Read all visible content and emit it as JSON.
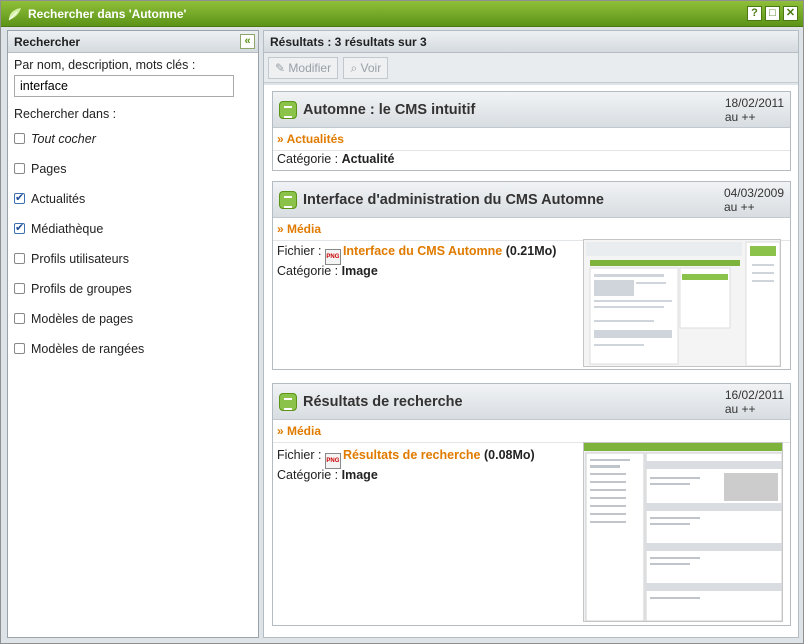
{
  "window": {
    "title": "Rechercher dans 'Automne'",
    "btn_help": "?",
    "btn_max": "□",
    "btn_close": "✕"
  },
  "left": {
    "header": "Rechercher",
    "collapse": "«",
    "search_label": "Par nom, description, mots clés :",
    "search_value": "interface",
    "search_in_label": "Rechercher dans :",
    "checkboxes": [
      {
        "label": "Tout cocher",
        "checked": false
      },
      {
        "label": "Pages",
        "checked": false
      },
      {
        "label": "Actualités",
        "checked": true
      },
      {
        "label": "Médiathèque",
        "checked": true
      },
      {
        "label": "Profils utilisateurs",
        "checked": false
      },
      {
        "label": "Profils de groupes",
        "checked": false
      },
      {
        "label": "Modèles de pages",
        "checked": false
      },
      {
        "label": "Modèles de rangées",
        "checked": false
      }
    ]
  },
  "right": {
    "header": "Résultats : 3 résultats sur 3",
    "modify_label": "Modifier",
    "view_label": "Voir"
  },
  "results": [
    {
      "title": "Automne : le CMS intuitif",
      "date": "18/02/2011",
      "by": "au ++",
      "module": "» Actualités",
      "category_label": "Catégorie :",
      "category": "Actualité"
    },
    {
      "title": "Interface d'administration du CMS Automne",
      "date": "04/03/2009",
      "by": "au ++",
      "module": "» Média",
      "file_label": "Fichier :",
      "file_name": "Interface du CMS Automne",
      "file_size": "(0.21Mo)",
      "file_type": "PNG",
      "category_label": "Catégorie :",
      "category": "Image"
    },
    {
      "title": "Résultats de recherche",
      "date": "16/02/2011",
      "by": "au ++",
      "module": "» Média",
      "file_label": "Fichier :",
      "file_name": "Résultats de recherche",
      "file_size": "(0.08Mo)",
      "file_type": "PNG",
      "category_label": "Catégorie :",
      "category": "Image"
    }
  ]
}
